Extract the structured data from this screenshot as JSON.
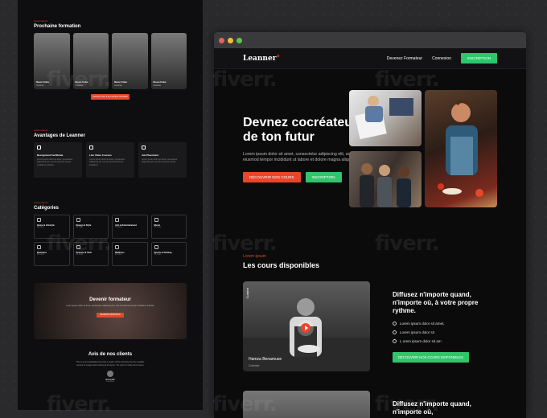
{
  "watermark": "fiverr.",
  "left": {
    "next": {
      "eyebrow": "Lorem ipsum",
      "title": "Prochaine formation",
      "cards": [
        {
          "name": "Ibson Fobs",
          "role": "Cuisinier"
        },
        {
          "name": "Ibson Fobs",
          "role": "Cuisinier"
        },
        {
          "name": "Ibson Fobs",
          "role": "Cuisinier"
        },
        {
          "name": "Ibson Fobs",
          "role": "Cuisinier"
        }
      ],
      "button": "Inscrivez-vous à la prochaine formation"
    },
    "advantages": {
      "eyebrow": "Lorem ipsum",
      "title": "Avantages de Leanner",
      "items": [
        {
          "title": "Recognized Certificate",
          "desc": "Lorem ipsum dolor sit amet, consectetur adipiscing elit, sed do eiusmod tempor incididunt ut labore"
        },
        {
          "title": "Live Video Courses",
          "desc": "Lorem ipsum dolor sit amet, consectetur adipiscing elit, sed do eiusmod tempor incididunt"
        },
        {
          "title": "Job Placement",
          "desc": "Lorem ipsum dolor sit amet, consectetur adipiscing elit, sed do eiusmod tempor"
        }
      ]
    },
    "categories": {
      "eyebrow": "Lorem ipsum",
      "title": "Catégories",
      "items": [
        {
          "name": "Home & Lifestyle",
          "count": "23 cours"
        },
        {
          "name": "Design & Style",
          "count": "23 cours"
        },
        {
          "name": "Arts & Entertainment",
          "count": "23 cours"
        },
        {
          "name": "Music",
          "count": "23 cours"
        },
        {
          "name": "Business",
          "count": "23 cours"
        },
        {
          "name": "Science & Tech",
          "count": "23 cours"
        },
        {
          "name": "Wellness",
          "count": "23 cours"
        },
        {
          "name": "Sports & Gaming",
          "count": "23 cours"
        }
      ]
    },
    "banner": {
      "title": "Devenir formateur",
      "desc": "Lorem ipsum dolor sit amet, consectetur adipiscing elit, sed do eiusmod tempor incididunt ut labore",
      "button": "DEVENIR FORMATEUR"
    },
    "reviews": {
      "title": "Avis de nos clients",
      "quote": "This is a long established fact that a reader will be distracted by the readable content of a page when looking at its layout. The point of using lorem ipsum.",
      "name": "Ali Rayhan",
      "role": "Formateur"
    }
  },
  "browser": {
    "nav": {
      "logo": "Leanner",
      "logo_accent": "°",
      "links": [
        "Devenez Formateur",
        "Connexion"
      ],
      "cta": "INSCRIPTION"
    },
    "hero": {
      "title": "Devnez cocréateur de ton futur",
      "desc": "Lorem ipsum dolor sit amet, consectetur adipiscing elit, sed do eiusmod tempor incididunt ut labore et dolore magna aliqua.",
      "primary": "DÉCOUVRIR NOS COURS",
      "secondary": "INSCRIPTION"
    },
    "courses": {
      "eyebrow": "Lorem ipsum",
      "title": "Les cours disponibles"
    },
    "video": {
      "side": "Cuisine",
      "name": "Hamza Benamuse",
      "role": "Cuisinier"
    },
    "feature": {
      "title": "Diffusez n'importe quand, n'importe où, à votre propre rythme.",
      "items": [
        "Lorem ipsum dolor sit amet,",
        "Lorem ipsum dolor sit",
        "L orem ipsum dolor sit am"
      ],
      "button": "DÉCOUVRIR NOS COURS DISPONIBLES"
    },
    "feature2": "Diffusez n'importe quand, n'importe où,"
  },
  "colors": {
    "accent_red": "#e8452b",
    "accent_green": "#31c46b",
    "page_bg": "#2a2a2d",
    "site_bg": "#0b0b0c"
  }
}
